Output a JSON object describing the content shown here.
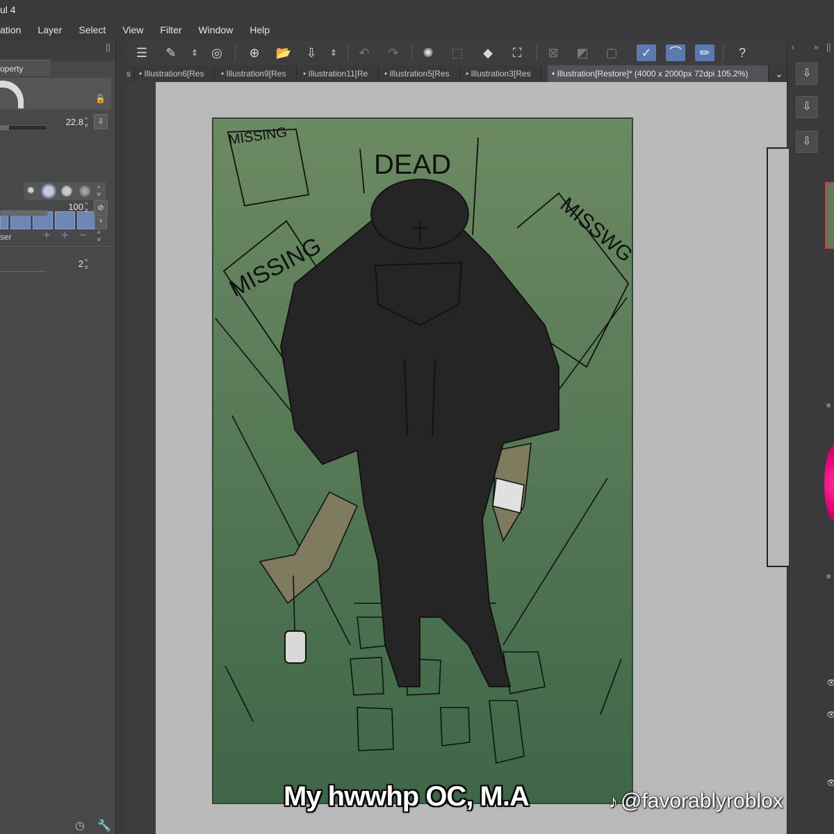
{
  "app": {
    "title": "ul 4"
  },
  "menu": [
    "ation",
    "Layer",
    "Select",
    "View",
    "Filter",
    "Window",
    "Help"
  ],
  "left_panel": {
    "tab_label": "operty",
    "size_value": "22.8",
    "opacity_value": "100",
    "label_eraser": "ser",
    "stabilization_value": "2",
    "swatch_color": "#6d87b4"
  },
  "toolbar": {
    "icons": [
      "menu-icon",
      "brush-settings-icon",
      "updown-icon",
      "spiral-icon",
      "new-canvas-icon",
      "open-folder-icon",
      "save-icon",
      "updown2-icon",
      "undo-icon",
      "redo-icon",
      "loading-icon",
      "deselect-icon",
      "fill-icon",
      "transform-icon",
      "clear-icon",
      "invert-icon",
      "border-icon",
      "pen-select-icon",
      "brush-icon",
      "pencil-icon",
      "help-icon"
    ]
  },
  "tabs": [
    {
      "label": "s",
      "active": false
    },
    {
      "label": "• Illustration6[Res",
      "active": false
    },
    {
      "label": "• Illustration9[Res",
      "active": false
    },
    {
      "label": "• Illustration11[Re",
      "active": false
    },
    {
      "label": "• Illustration5[Res",
      "active": false
    },
    {
      "label": "• Illustration3[Res",
      "active": false
    },
    {
      "label": "• Illustration[Restore]* (4000 x 2000px 72dpi 105.2%)",
      "active": true
    }
  ],
  "artwork": {
    "poster_texts": [
      "MISSING",
      "DEAD",
      "MISSING",
      "MISSWG"
    ],
    "colors": {
      "background_top": "#6b8a62",
      "background_bottom": "#3f6648",
      "figure": "#252526",
      "skin": "#7e7a5e"
    }
  },
  "overlay": {
    "caption": "My hwwhp OC, M.A",
    "watermark": "@favorablyroblox"
  }
}
